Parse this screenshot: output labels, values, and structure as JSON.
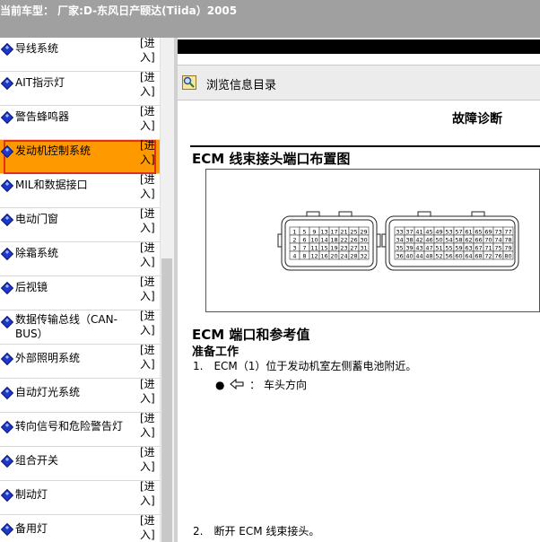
{
  "title_bar": {
    "text": "当前车型： 厂家:D-东风日产颐达(Tiida）2005"
  },
  "sidebar": {
    "enter_label": "[进入]",
    "items": [
      {
        "label": "导线系统"
      },
      {
        "label": "AIT指示灯"
      },
      {
        "label": "警告蜂鸣器"
      },
      {
        "label": "发动机控制系统"
      },
      {
        "label": "MIL和数据接口"
      },
      {
        "label": "电动门窗"
      },
      {
        "label": "除霜系统"
      },
      {
        "label": "后视镜"
      },
      {
        "label": "数据传输总线（CAN-BUS）"
      },
      {
        "label": "外部照明系统"
      },
      {
        "label": "自动灯光系统"
      },
      {
        "label": "转向信号和危险警告灯"
      },
      {
        "label": "组合开关"
      },
      {
        "label": "制动灯"
      },
      {
        "label": "备用灯"
      }
    ],
    "active_index": 3
  },
  "browse": {
    "label": "浏览信息目录"
  },
  "document": {
    "title": "故障诊断",
    "section1": "ECM 线束接头端口布置图",
    "connector_left": [
      [
        "1",
        "5",
        "9",
        "13",
        "17",
        "21",
        "25",
        "29"
      ],
      [
        "2",
        "6",
        "10",
        "14",
        "18",
        "22",
        "26",
        "30"
      ],
      [
        "3",
        "7",
        "11",
        "15",
        "19",
        "23",
        "27",
        "31"
      ],
      [
        "4",
        "8",
        "12",
        "16",
        "20",
        "24",
        "28",
        "32"
      ]
    ],
    "connector_right": [
      [
        "33",
        "37",
        "41",
        "45",
        "49",
        "53",
        "57",
        "61",
        "65",
        "69",
        "73",
        "77"
      ],
      [
        "34",
        "38",
        "42",
        "46",
        "50",
        "54",
        "58",
        "62",
        "66",
        "70",
        "74",
        "78"
      ],
      [
        "35",
        "39",
        "43",
        "47",
        "51",
        "55",
        "59",
        "63",
        "67",
        "71",
        "75",
        "79"
      ],
      [
        "36",
        "40",
        "44",
        "48",
        "52",
        "56",
        "60",
        "64",
        "68",
        "72",
        "76",
        "80"
      ]
    ],
    "section2": "ECM 端口和参考值",
    "subsection": "准备工作",
    "step1": "1.　ECM（1）位于发动机室左侧蓄电池附近。",
    "bullet1": "车头方向",
    "step2": "2.　断开 ECM 线束接头。"
  },
  "colors": {
    "active_bg": "#ff9900",
    "active_outline": "#e03020",
    "diamond": "#2038c8",
    "title_bar": "#a0a0a0"
  }
}
